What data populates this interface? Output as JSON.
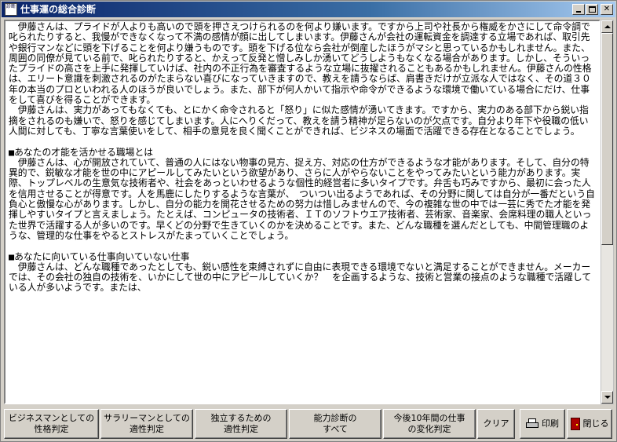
{
  "window": {
    "icon_text": "診断",
    "title": "仕事運の総合診断"
  },
  "content": {
    "text": "　伊藤さんは、プライドが人よりも高いので頭を押さえつけられるのを何より嫌います。ですから上司や社長から権威をかさにして命令調で叱られたりすると、我慢ができなくなって不満の感情が顔に出してしまいます。伊藤さんが会社の運転資金を調達する立場であれば、取引先や銀行マンなどに頭を下げることを何より嫌うものです。頭を下げる位なら会社が倒産したほうがマシと思っているかもしれません。また、周囲の同僚が見ている前で、叱られたりすると、かえって反発と憎しみしか湧いてどうしようもなくなる場合があります。しかし、そういったプライドの高さを上手に発揮していけば、社内の不正行為を審査するような立場に抜擢されることもあるかもしれません。伊藤さんの性格は、エリート意識を刺激されるのがたまらない喜びになっていきますので、教えを請うならば、肩書きだけが立派な人ではなく、その道３０年の本当のプロといわれる人のほうが良いでしょう。また、部下が何人かいて指示や命令ができるような環境で働いている場合にだけ、仕事をして喜びを得ることができます。\n　伊藤さんは、実力があってもなくても、とにかく命令されると「怒り」に似た感情が湧いてきます。ですから、実力のある部下から鋭い指摘をされるのも嫌いで、怒りを感じてしまいます。人にへりくだって、教えを請う精神が足らないのが欠点です。自分より年下や役職の低い人間に対しても、丁寧な言葉使いをして、相手の意見を良く聞くことができれば、ビジネスの場面で活躍できる存在となることでしょう。\n\n■あなたの才能を活かせる職場とは\n　伊藤さんは、心が開放されていて、普通の人にはない物事の見方、捉え方、対応の仕方ができるような才能があります。そして、自分の特異的で、鋭敏な才能を世の中にアピールしてみたいという欲望があり、さらに人がやらないことをやってみたいという能力があります。実際、トップレベルの生意気な技術者や、社会をあっといわせるような個性的経営者に多いタイプです。弁舌も巧みですから、最初に会った人を信用させることが得意です。人を馬鹿にしたりするような言葉が、　ついつい出るようであれば、その分野に関しては自分が一番だという自負心と傲慢な心があります。しかし、自分の能力を開花させるための努力は惜しみませんので、今の複雑な世の中では一芸に秀でた才能を発揮しやすいタイプと言えましょう。たとえば、コンピュータの技術者、ＩＴのソフトウエア技術者、芸術家、音楽家、会席料理の職人といった世界で活躍する人が多いのです。早くどの分野で生きていくのかを決めることです。また、どんな職種を選んだとしても、中間管理職のような、管理的な仕事をやるとストレスがたまっていくことでしょう。\n\n■あなたに向いている仕事向いていない仕事\n　伊藤さんは、どんな職種であったとしても、鋭い感性を束縛されずに自由に表現できる環境でないと満足することができません。メーカーでは、その会社の独自の技術を、いかにして世の中にアピールしていくか？　を企画するような、技術と営業の接点のような職種で活躍している人が多いようです。または、"
  },
  "buttons": {
    "business": "ビジネスマンとしての\n性格判定",
    "salaryman": "サラリーマンとしての\n適性判定",
    "independent": "独立するための\n適性判定",
    "ability": "能力診断の\nすべて",
    "future": "今後10年間の仕事\nの変化判定",
    "clear": "クリア",
    "print": "印刷",
    "close": "閉じる"
  },
  "icons": {
    "print": "printer-icon",
    "close": "exit-door-icon"
  },
  "colors": {
    "titlebar_start": "#0a246a",
    "titlebar_end": "#a6caf0",
    "face": "#d4d0c8"
  }
}
